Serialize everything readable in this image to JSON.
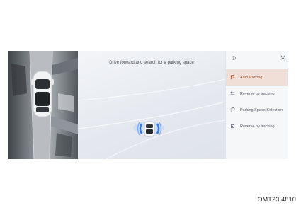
{
  "guide_text": "Drive forward and search for a parking space",
  "menu": {
    "items": [
      {
        "label": "Auto Parking",
        "icon": "auto-parking-icon",
        "active": true
      },
      {
        "label": "Reverse by tracking",
        "icon": "reverse-tracking-icon",
        "active": false
      },
      {
        "label": "Parking Space Selection",
        "icon": "parking-space-selection-icon",
        "active": false
      },
      {
        "label": "Reverse by tracking",
        "icon": "reverse-tracking-icon",
        "active": false
      }
    ]
  },
  "panel_icons": {
    "settings": "gear-icon",
    "close": "close-icon"
  },
  "caption": "OMT23 4810",
  "colors": {
    "active_bg": "#f0dfd6",
    "active_text": "#a65a3a",
    "sensor_blue": "#2e7bff"
  }
}
